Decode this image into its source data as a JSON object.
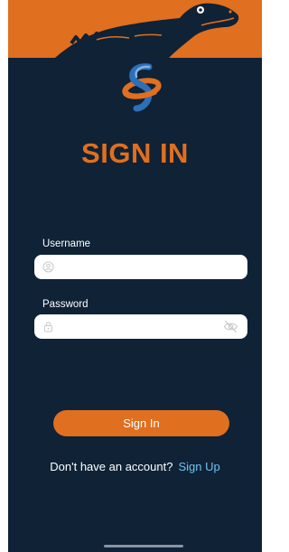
{
  "theme": {
    "background": "#0f2236",
    "accent": "#e06f1f",
    "link": "#6cc4f0",
    "field_bg": "#ffffff"
  },
  "header": {
    "graphic": "alligator-mascot",
    "logo": "orange-blue-s-swoosh-logo"
  },
  "form": {
    "title": "SIGN IN",
    "username": {
      "label": "Username",
      "value": "",
      "icon": "user-icon"
    },
    "password": {
      "label": "Password",
      "value": "",
      "icon": "lock-icon",
      "toggle_icon": "eye-off-icon"
    },
    "submit_label": "Sign In"
  },
  "footer": {
    "prompt": "Don't have an account?",
    "link_label": "Sign Up"
  }
}
